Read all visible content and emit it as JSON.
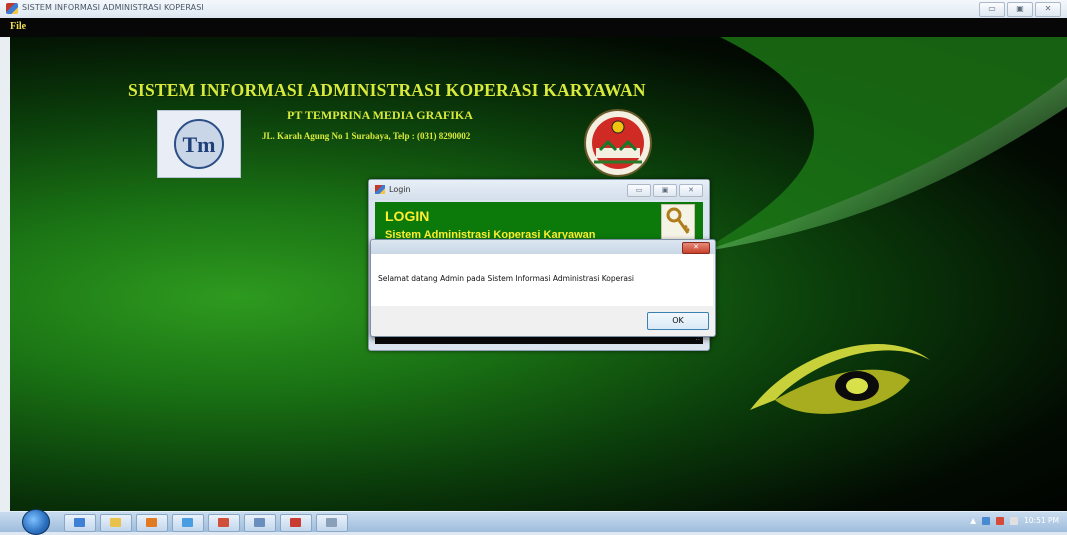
{
  "window": {
    "title": "SISTEM INFORMASI ADMINISTRASI KOPERASI",
    "controls": [
      "minimize",
      "restore",
      "close"
    ],
    "minimize_glyph": "▭",
    "restore_glyph": "▣",
    "close_glyph": "✕"
  },
  "menu": {
    "file": "File"
  },
  "header": {
    "title": "SISTEM INFORMASI ADMINISTRASI KOPERASI KARYAWAN",
    "company": "PT TEMPRINA MEDIA GRAFIKA",
    "address": "JL. Karah Agung No 1 Surabaya, Telp : (031) 8290002",
    "color": "#d8ea3c"
  },
  "logos": {
    "left_icon": "tm-logo-icon",
    "right_icon": "koperasi-emblem-icon"
  },
  "login_window": {
    "title": "Login",
    "heading": "LOGIN",
    "subheading": "Sistem Administrasi Koperasi Karyawan",
    "icon": "key-icon",
    "grip": ".:"
  },
  "message_box": {
    "text": "Selamat datang Admin pada Sistem Informasi Administrasi Koperasi",
    "ok_label": "OK",
    "close_glyph": "✕"
  },
  "taskbar": {
    "clock": "10:51 PM",
    "tray_chevron": "▲",
    "icons": [
      "start-orb-icon",
      "pen-icon",
      "folder-icon",
      "media-icon",
      "app-icon",
      "paint-icon",
      "app-icon",
      "app-icon",
      "app-icon"
    ]
  }
}
